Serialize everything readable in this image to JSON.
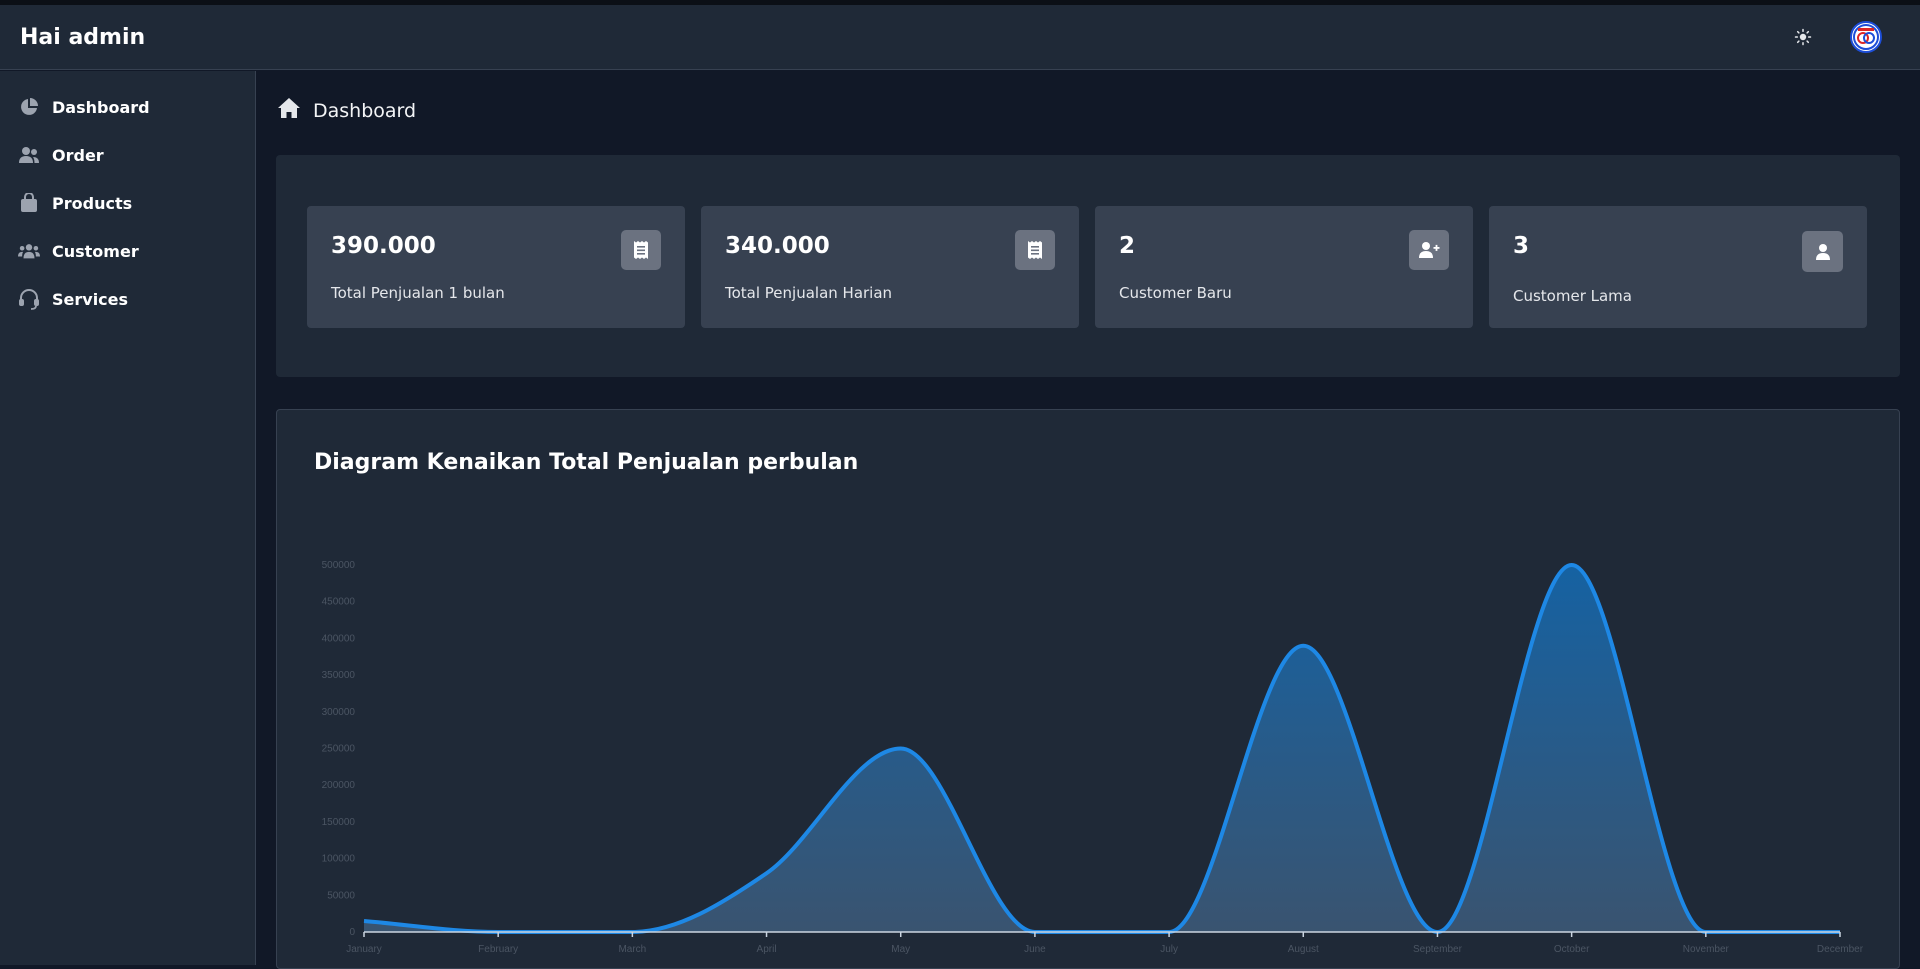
{
  "header": {
    "greeting": "Hai admin",
    "theme_toggle_icon": "sun-icon",
    "avatar_icon": "avatar-logo"
  },
  "sidebar": {
    "items": [
      {
        "label": "Dashboard",
        "icon": "pie-chart-icon"
      },
      {
        "label": "Order",
        "icon": "users-icon"
      },
      {
        "label": "Products",
        "icon": "shopping-bag-icon"
      },
      {
        "label": "Customer",
        "icon": "user-group-icon"
      },
      {
        "label": "Services",
        "icon": "headset-icon"
      }
    ]
  },
  "breadcrumb": {
    "label": "Dashboard",
    "icon": "home-icon"
  },
  "stats": [
    {
      "value": "390.000",
      "label": "Total Penjualan 1 bulan",
      "icon": "receipt-icon"
    },
    {
      "value": "340.000",
      "label": "Total Penjualan Harian",
      "icon": "receipt-icon"
    },
    {
      "value": "2",
      "label": "Customer Baru",
      "icon": "user-plus-icon"
    },
    {
      "value": "3",
      "label": "Customer Lama",
      "icon": "user-icon"
    }
  ],
  "colors": {
    "accent_line": "#1e88e5",
    "panel": "#1f2937",
    "card": "#374151"
  },
  "chart_data": {
    "type": "area",
    "title": "Diagram Kenaikan Total Penjualan perbulan",
    "categories": [
      "January",
      "February",
      "March",
      "April",
      "May",
      "June",
      "July",
      "August",
      "September",
      "October",
      "November",
      "December"
    ],
    "values": [
      15000,
      0,
      0,
      80000,
      250000,
      0,
      0,
      390000,
      0,
      500000,
      0,
      0
    ],
    "y_ticks": [
      "0",
      "50000",
      "100000",
      "150000",
      "200000",
      "250000",
      "300000",
      "350000",
      "400000",
      "450000",
      "500000"
    ],
    "ylim": [
      0,
      500000
    ],
    "grid": false,
    "legend": "none"
  }
}
